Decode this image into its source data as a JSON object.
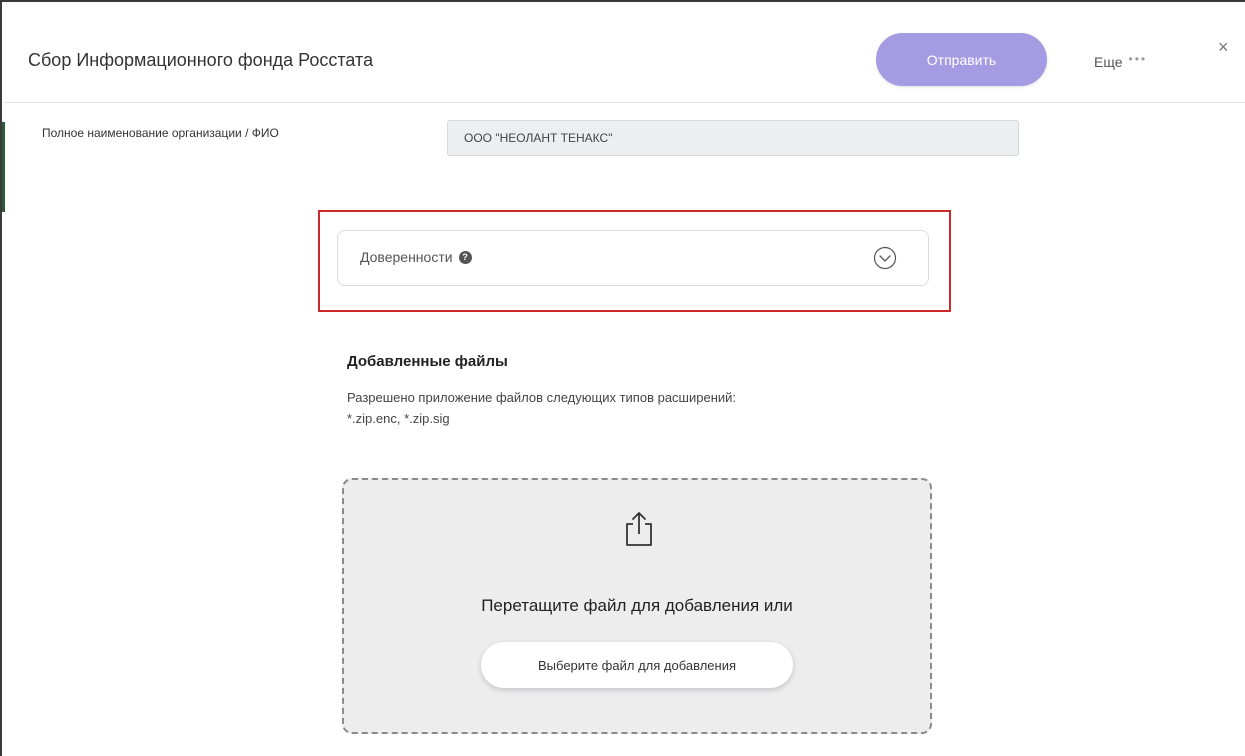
{
  "header": {
    "title": "Сбор Информационного фонда Росстата",
    "send_label": "Отправить",
    "more_label": "Еще",
    "more_dots": "•••",
    "close_label": "×"
  },
  "org": {
    "label": "Полное наименование организации / ФИО",
    "value": "ООО \"НЕОЛАНТ ТЕНАКС\""
  },
  "accordion": {
    "label": "Доверенности",
    "help_glyph": "?",
    "expanded": false
  },
  "files": {
    "title": "Добавленные файлы",
    "description_line1": "Разрешено приложение файлов следующих типов расширений:",
    "description_line2": "*.zip.enc, *.zip.sig"
  },
  "dropzone": {
    "prompt": "Перетащите файл для добавления или",
    "choose_label": "Выберите файл для добавления"
  },
  "colors": {
    "accent": "#a59be3",
    "highlight": "#cc2a2a",
    "field_bg": "#eceef0",
    "dropzone_bg": "#ededee"
  },
  "icons": {
    "help": "question-circle-icon",
    "chevron": "chevron-down-circle-icon",
    "upload": "upload-icon",
    "close": "close-icon",
    "more": "more-dots-icon"
  }
}
